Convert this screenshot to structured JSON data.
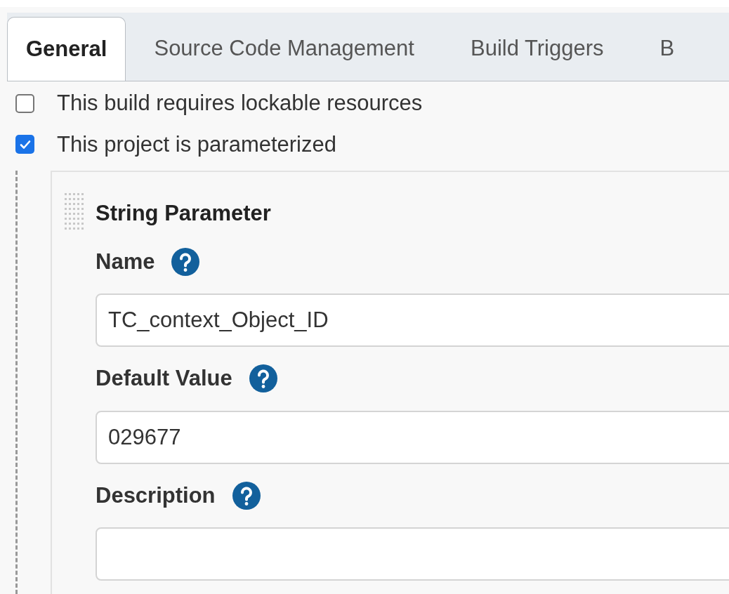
{
  "tabs": [
    {
      "label": "General",
      "selected": true
    },
    {
      "label": "Source Code Management",
      "selected": false
    },
    {
      "label": "Build Triggers",
      "selected": false
    },
    {
      "label": "B",
      "selected": false
    }
  ],
  "options": [
    {
      "label": "This build requires lockable resources",
      "checked": false
    },
    {
      "label": "This project is parameterized",
      "checked": true
    }
  ],
  "parameter": {
    "title": "String Parameter",
    "fields": [
      {
        "label": "Name",
        "value": "TC_context_Object_ID"
      },
      {
        "label": "Default Value",
        "value": "029677"
      },
      {
        "label": "Description"
      }
    ]
  }
}
